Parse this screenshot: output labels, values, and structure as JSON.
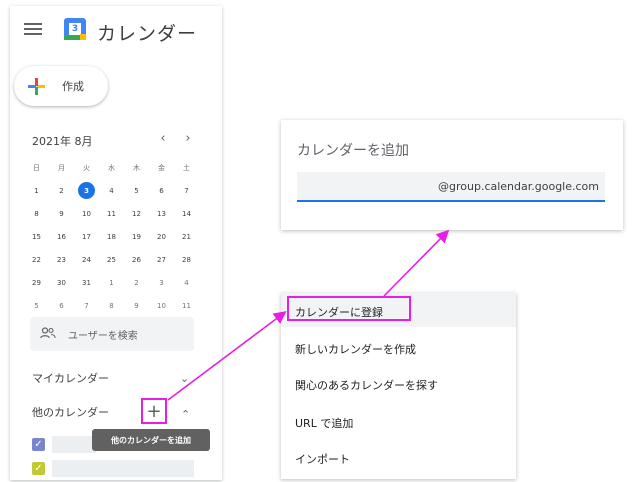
{
  "app": {
    "title": "カレンダー",
    "logo_day": "3",
    "create_label": "作成"
  },
  "mini_calendar": {
    "month_label": "2021年 8月",
    "prev": "‹",
    "next": "›",
    "weekdays": [
      "日",
      "月",
      "火",
      "水",
      "木",
      "金",
      "土"
    ],
    "weeks": [
      [
        "1",
        "2",
        "3",
        "4",
        "5",
        "6",
        "7"
      ],
      [
        "8",
        "9",
        "10",
        "11",
        "12",
        "13",
        "14"
      ],
      [
        "15",
        "16",
        "17",
        "18",
        "19",
        "20",
        "21"
      ],
      [
        "22",
        "23",
        "24",
        "25",
        "26",
        "27",
        "28"
      ],
      [
        "29",
        "30",
        "31",
        "1",
        "2",
        "3",
        "4"
      ],
      [
        "5",
        "6",
        "7",
        "8",
        "9",
        "10",
        "11"
      ]
    ],
    "today": "3"
  },
  "search_users": {
    "label": "ユーザーを検索"
  },
  "my_calendars": {
    "label": "マイカレンダー"
  },
  "other_calendars": {
    "label": "他のカレンダー",
    "add_icon": "+",
    "tooltip": "他のカレンダーを追加"
  },
  "calendar_colors": {
    "first": "#7986cb",
    "second": "#c0ca33"
  },
  "add_calendar_dialog": {
    "title": "カレンダーを追加",
    "input_value": "@group.calendar.google.com"
  },
  "add_menu": {
    "items": [
      "カレンダーに登録",
      "新しいカレンダーを作成",
      "関心のあるカレンダーを探す",
      "URL で追加",
      "インポート"
    ]
  },
  "annotation_color": "#e61ee6"
}
